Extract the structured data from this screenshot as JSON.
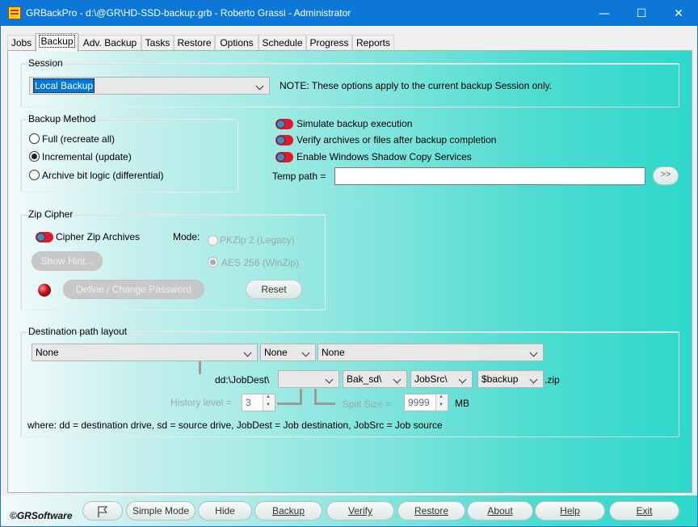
{
  "window": {
    "title": "GRBackPro - d:\\@GR\\HD-SSD-backup.grb - Roberto Grassi - Administrator",
    "controls": {
      "minimize": "—",
      "maximize": "☐",
      "close": "✕"
    }
  },
  "tabs": [
    {
      "label": "Jobs",
      "active": false
    },
    {
      "label": "Backup",
      "active": true
    },
    {
      "label": "Adv. Backup",
      "active": false
    },
    {
      "label": "Tasks",
      "active": false
    },
    {
      "label": "Restore",
      "active": false
    },
    {
      "label": "Options",
      "active": false
    },
    {
      "label": "Schedule",
      "active": false
    },
    {
      "label": "Progress",
      "active": false
    },
    {
      "label": "Reports",
      "active": false
    }
  ],
  "session": {
    "legend": "Session",
    "selected": "Local Backup",
    "note": "NOTE: These options apply to the current backup Session only."
  },
  "backup_method": {
    "legend": "Backup Method",
    "options": [
      {
        "label": "Full (recreate all)",
        "checked": false
      },
      {
        "label": "Incremental (update)",
        "checked": true
      },
      {
        "label": "Archive bit logic (differential)",
        "checked": false
      }
    ]
  },
  "toggles": {
    "simulate": "Simulate backup execution",
    "verify": "Verify archives or files after backup completion",
    "shadow": "Enable Windows Shadow Copy Services"
  },
  "temp_path": {
    "label": "Temp path =",
    "value": "",
    "browse": ">>"
  },
  "zip_cipher": {
    "legend": "Zip Cipher",
    "cipher_label": "Cipher Zip Archives",
    "mode_label": "Mode:",
    "pkzip": "PKZip 2 (Legacy)",
    "aes": "AES 256 (WinZip)",
    "show_hint": "Show Hint...",
    "define_password": "Define / Change Password",
    "reset": "Reset"
  },
  "destination": {
    "legend": "Destination path layout",
    "combo1": "None",
    "combo2": "None",
    "combo3": "None",
    "prefix": "dd:\\JobDest\\",
    "part1": "",
    "part2": "Bak_sd\\",
    "part3": "JobSrc\\",
    "part4": "$backup",
    "ext": ".zip",
    "history_label": "History level =",
    "history_value": "3",
    "split_label": "Split Size =",
    "split_value": "9999",
    "split_unit": "MB",
    "legend_text": "where: dd = destination drive, sd = source drive, JobDest = Job destination, JobSrc = Job source"
  },
  "bottom": {
    "brand": "©GRSoftware",
    "simple_mode": "Simple Mode",
    "hide": "Hide",
    "backup": "Backup",
    "verify": "Verify",
    "restore": "Restore",
    "about": "About",
    "help": "Help",
    "exit": "Exit"
  }
}
